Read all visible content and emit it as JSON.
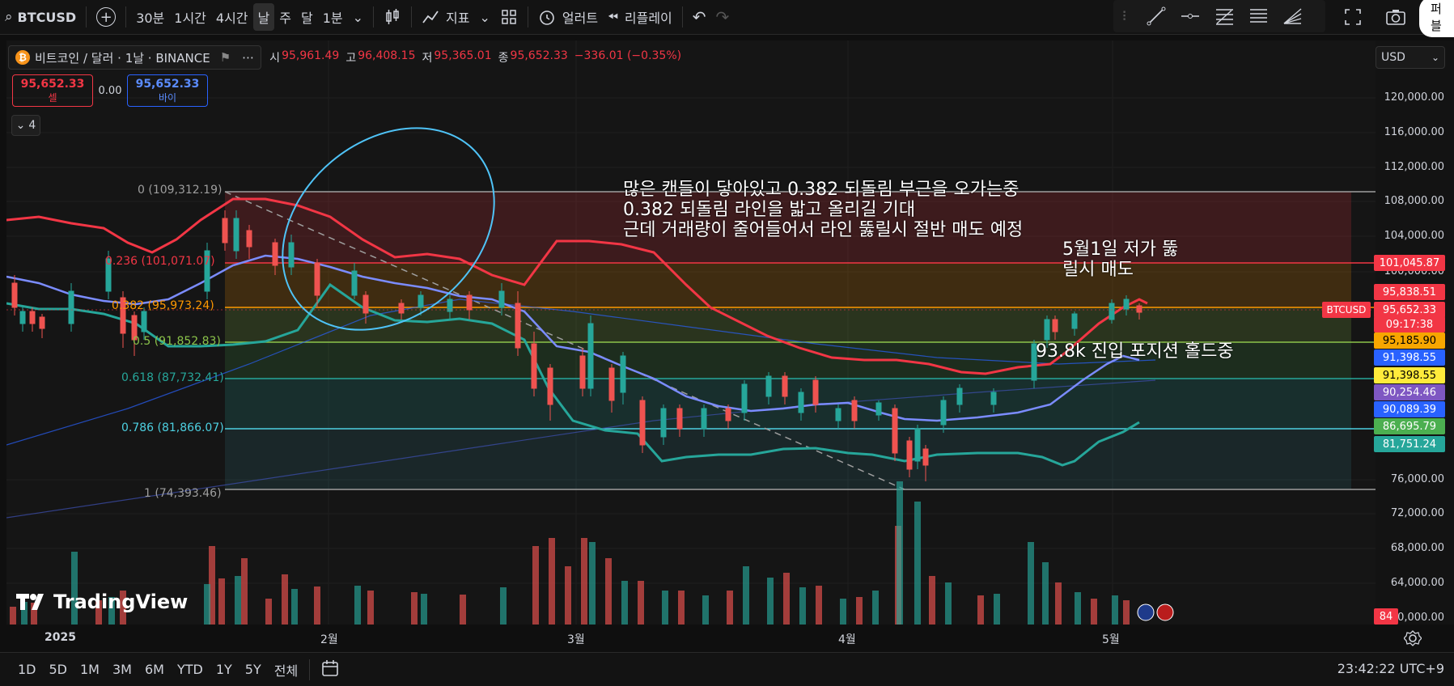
{
  "toolbar": {
    "symbol": "BTCUSD",
    "intervals": [
      "30분",
      "1시간",
      "4시간",
      "날",
      "주",
      "달",
      "1분"
    ],
    "active_interval_index": 3,
    "indicators_label": "지표",
    "alert_label": "얼러트",
    "replay_label": "리플레이",
    "publish_label": "퍼블"
  },
  "legend": {
    "title": "비트코인 / 달러 · 1날 · BINANCE",
    "open_key": "시",
    "open": "95,961.49",
    "high_key": "고",
    "high": "96,408.15",
    "low_key": "저",
    "low": "95,365.01",
    "close_key": "종",
    "close": "95,652.33",
    "change": "−336.01 (−0.35%)",
    "sell_price": "95,652.33",
    "sell_label": "셀",
    "spread": "0.00",
    "buy_price": "95,652.33",
    "buy_label": "바이",
    "collapsed_count": "4"
  },
  "currency": "USD",
  "price_axis": {
    "ticks": [
      "120,000.00",
      "116,000.00",
      "112,000.00",
      "108,000.00",
      "104,000.00",
      "100,000.00",
      "76,000.00",
      "72,000.00",
      "68,000.00",
      "64,000.00",
      "60,000.00"
    ],
    "tags": [
      {
        "text": "101,045.87",
        "color": "#f23645"
      },
      {
        "text": "95,838.51",
        "color": "#f23645"
      },
      {
        "text": "95,652.33",
        "color": "#f23645"
      },
      {
        "text": "09:17:38",
        "color": "#f23645"
      },
      {
        "text": "95,185.90",
        "color": "#f7a600"
      },
      {
        "text": "91,398.55",
        "color": "#2962ff"
      },
      {
        "text": "91,398.55",
        "color": "#ffeb3b"
      },
      {
        "text": "90,254.46",
        "color": "#7e57c2"
      },
      {
        "text": "90,089.39",
        "color": "#2962ff"
      },
      {
        "text": "86,695.79",
        "color": "#4caf50"
      },
      {
        "text": "81,751.24",
        "color": "#26a69a"
      },
      {
        "text": "84",
        "color": "#f23645"
      }
    ],
    "symbol_tag": "BTCUSD"
  },
  "fib": [
    {
      "label": "0 (109,312.19)",
      "color": "#9e9e9e"
    },
    {
      "label": "0.236 (101,071.07)",
      "color": "#f23645"
    },
    {
      "label": "0.382 (95,973.24)",
      "color": "#ff9800"
    },
    {
      "label": "0.5 (91,852.83)",
      "color": "#8bc34a"
    },
    {
      "label": "0.618 (87,732.41)",
      "color": "#26a69a"
    },
    {
      "label": "0.786 (81,866.07)",
      "color": "#4dd0e1"
    },
    {
      "label": "1 (74,393.46)",
      "color": "#9e9e9e"
    }
  ],
  "annotations": {
    "main_line1": "많은 캔들이 닿아있고 0.382 되돌림 부근을 오가는중",
    "main_line2": "0.382 되돌림 라인을 밟고 올리길 기대",
    "main_line3": "근데 거래량이 줄어들어서 라인 뚫릴시 절반 매도 예정",
    "may_line1": "5월1일 저가 뚫",
    "may_line2": "릴시 매도",
    "hold": "93.8k 진입 포지션 홀드중"
  },
  "time_axis": [
    "2025",
    "2월",
    "3월",
    "4월",
    "5월"
  ],
  "bottom": {
    "ranges": [
      "1D",
      "5D",
      "1M",
      "3M",
      "6M",
      "YTD",
      "1Y",
      "5Y",
      "전체"
    ],
    "clock": "23:42:22 UTC+9"
  },
  "logo": "TradingView"
}
